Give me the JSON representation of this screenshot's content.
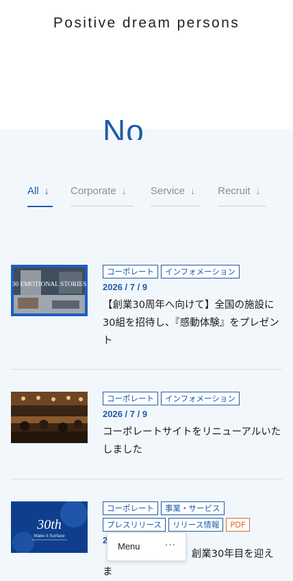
{
  "header": {
    "brand": "Positive dream persons"
  },
  "section": {
    "heading": "No"
  },
  "tabs": [
    {
      "label": "All",
      "arrow": "↓"
    },
    {
      "label": "Corporate",
      "arrow": "↓"
    },
    {
      "label": "Service",
      "arrow": "↓"
    },
    {
      "label": "Recruit",
      "arrow": "↓"
    }
  ],
  "news": [
    {
      "tags": [
        "コーポレート",
        "インフォメーション"
      ],
      "date": "2026 / 7 / 9",
      "title": "【創業30周年へ向けて】全国の施設に30組を招待し、『感動体験』をプレゼント",
      "thumb_text": "30 EMOTIONAL STORIES"
    },
    {
      "tags": [
        "コーポレート",
        "インフォメーション"
      ],
      "date": "2026 / 7 / 9",
      "title": "コーポレートサイトをリニューアルいたしました"
    },
    {
      "tags": [
        "コーポレート",
        "事業・サービス",
        "プレスリリース",
        "リリース情報"
      ],
      "pdf_tag": "PDF",
      "date": "2",
      "title": "【プレスリリース】創業30年目を迎えま",
      "thumb_text": "30th",
      "thumb_sub": "Make it Surface"
    }
  ],
  "menu": {
    "label": "Menu",
    "more": "···"
  },
  "colors": {
    "accent": "#1e5aa8",
    "pdf": "#e06a2b",
    "background": "#f2f7fc"
  }
}
